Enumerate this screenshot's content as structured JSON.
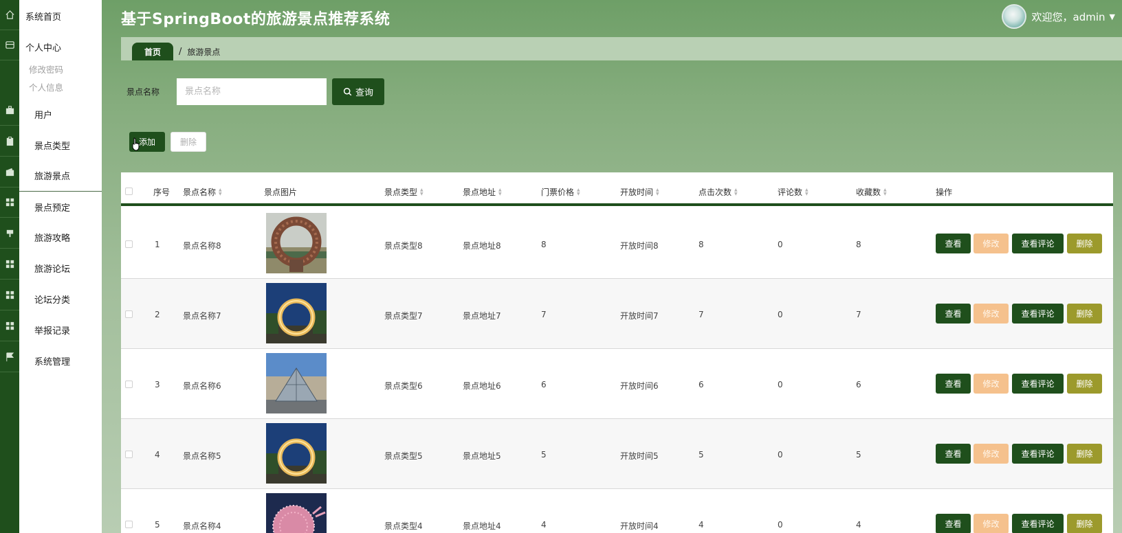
{
  "app": {
    "title": "基于SpringBoot的旅游景点推荐系统",
    "welcome": "欢迎您，admin",
    "accent": "#1f4f1c"
  },
  "sidebar": {
    "home": "系统首页",
    "personal": "个人中心",
    "change_password": "修改密码",
    "personal_info": "个人信息",
    "items": [
      "用户",
      "景点类型",
      "旅游景点",
      "景点预定",
      "旅游攻略",
      "旅游论坛",
      "论坛分类",
      "举报记录",
      "系统管理"
    ],
    "active": "旅游景点"
  },
  "breadcrumb": {
    "home": "首页",
    "separator": "/",
    "current": "旅游景点"
  },
  "search": {
    "label": "景点名称",
    "placeholder": "景点名称",
    "query_button": "查询"
  },
  "toolbar": {
    "add": "添加",
    "delete": "删除"
  },
  "table": {
    "columns": [
      "序号",
      "景点名称",
      "景点图片",
      "景点类型",
      "景点地址",
      "门票价格",
      "开放时间",
      "点击次数",
      "评论数",
      "收藏数",
      "操作"
    ],
    "rows": [
      {
        "index": "1",
        "name": "景点名称8",
        "type": "景点类型8",
        "address": "景点地址8",
        "price": "8",
        "open_time": "开放时间8",
        "clicks": "8",
        "comments": "0",
        "favorites": "8",
        "image": "wicker-ring-sculpture"
      },
      {
        "index": "2",
        "name": "景点名称7",
        "type": "景点类型7",
        "address": "景点地址7",
        "price": "7",
        "open_time": "开放时间7",
        "clicks": "7",
        "comments": "0",
        "favorites": "7",
        "image": "lit-ring-night"
      },
      {
        "index": "3",
        "name": "景点名称6",
        "type": "景点类型6",
        "address": "景点地址6",
        "price": "6",
        "open_time": "开放时间6",
        "clicks": "6",
        "comments": "0",
        "favorites": "6",
        "image": "glass-pyramid"
      },
      {
        "index": "4",
        "name": "景点名称5",
        "type": "景点类型5",
        "address": "景点地址5",
        "price": "5",
        "open_time": "开放时间5",
        "clicks": "5",
        "comments": "0",
        "favorites": "5",
        "image": "lit-ring-night"
      },
      {
        "index": "5",
        "name": "景点名称4",
        "type": "景点类型4",
        "address": "景点地址4",
        "price": "4",
        "open_time": "开放时间4",
        "clicks": "4",
        "comments": "0",
        "favorites": "4",
        "image": "lantern-sphere"
      }
    ],
    "actions": {
      "view": "查看",
      "edit": "修改",
      "view_comments": "查看评论",
      "delete": "删除"
    }
  }
}
